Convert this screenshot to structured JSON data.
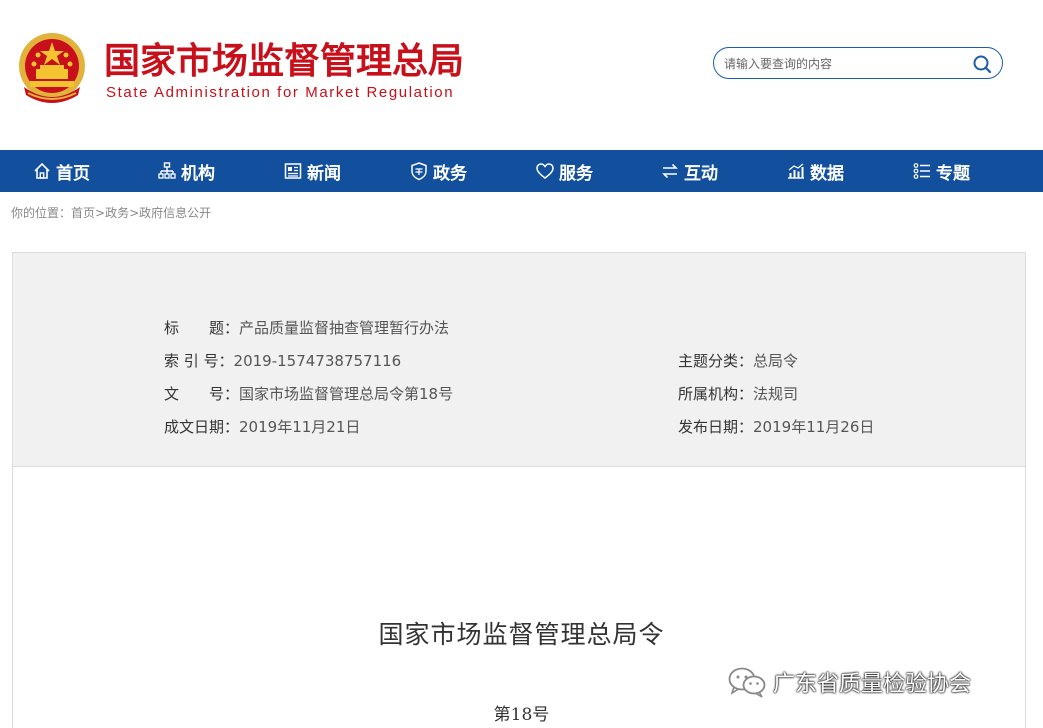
{
  "header": {
    "title": "国家市场监督管理总局",
    "subtitle": "State Administration for Market Regulation",
    "emblem_icon": "national-emblem-icon",
    "brand_color": "#c8101b"
  },
  "search": {
    "placeholder": "请输入要查询的内容",
    "icon": "search-icon"
  },
  "nav": {
    "color": "#12509d",
    "items": [
      {
        "label": "首页",
        "icon": "home-icon"
      },
      {
        "label": "机构",
        "icon": "org-chart-icon"
      },
      {
        "label": "新闻",
        "icon": "news-icon"
      },
      {
        "label": "政务",
        "icon": "shield-icon"
      },
      {
        "label": "服务",
        "icon": "heart-icon"
      },
      {
        "label": "互动",
        "icon": "exchange-arrows-icon"
      },
      {
        "label": "数据",
        "icon": "chart-icon"
      },
      {
        "label": "专题",
        "icon": "list-icon"
      }
    ]
  },
  "breadcrumb": {
    "prefix": "你的位置：",
    "items": [
      "首页",
      "政务",
      "政府信息公开"
    ],
    "separator": ">"
  },
  "meta": {
    "title_label": "标　　题：",
    "title_value": "产品质量监督抽查管理暂行办法",
    "index_label": "索 引 号：",
    "index_value": "2019-1574738757116",
    "topic_label": "主题分类：",
    "topic_value": "总局令",
    "docno_label": "文　　号：",
    "docno_value": "国家市场监督管理总局令第18号",
    "org_label": "所属机构：",
    "org_value": "法规司",
    "created_label": "成文日期：",
    "created_value": "2019年11月21日",
    "published_label": "发布日期：",
    "published_value": "2019年11月26日"
  },
  "document": {
    "heading": "国家市场监督管理总局令",
    "number": "第18号"
  },
  "watermark": {
    "text": "广东省质量检验协会",
    "icon": "wechat-icon"
  }
}
